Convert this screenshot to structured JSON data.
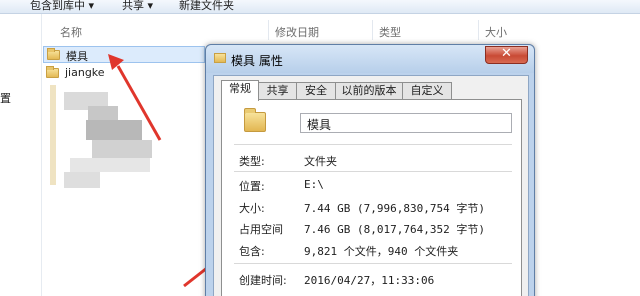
{
  "toolbar": {
    "include_library": "包含到库中 ▾",
    "share": "共享 ▾",
    "new_folder": "新建文件夹"
  },
  "columns": {
    "name": "名称",
    "modified": "修改日期",
    "type": "类型",
    "size": "大小"
  },
  "nav_pane": {
    "partial_text": "置"
  },
  "files": [
    {
      "name": "模具",
      "selected": true
    },
    {
      "name": "jiangke",
      "selected": false
    }
  ],
  "dialog": {
    "title": "模具 属性",
    "close_symbol": "✕",
    "tabs": [
      "常规",
      "共享",
      "安全",
      "以前的版本",
      "自定义"
    ],
    "name_value": "模具",
    "properties": {
      "type_label": "类型:",
      "type_value": "文件夹",
      "location_label": "位置:",
      "location_value": "E:\\",
      "size_label": "大小:",
      "size_value": "7.44 GB (7,996,830,754 字节)",
      "disk_size_label": "占用空间",
      "disk_size_value": "7.46 GB (8,017,764,352 字节)",
      "contains_label": "包含:",
      "contains_value": "9,821 个文件，940 个文件夹",
      "created_label": "创建时间:",
      "created_value": "2016/04/27，11:33:06"
    }
  },
  "colors": {
    "arrow": "#e0362c",
    "selection": "#dcebfc",
    "dialog_frame": "#bcd2ec"
  }
}
